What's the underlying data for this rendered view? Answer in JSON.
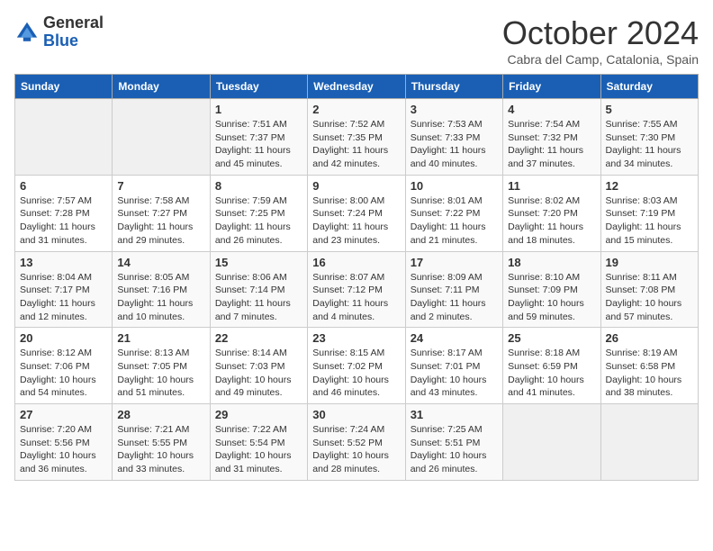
{
  "header": {
    "logo_general": "General",
    "logo_blue": "Blue",
    "month": "October 2024",
    "location": "Cabra del Camp, Catalonia, Spain"
  },
  "days_of_week": [
    "Sunday",
    "Monday",
    "Tuesday",
    "Wednesday",
    "Thursday",
    "Friday",
    "Saturday"
  ],
  "weeks": [
    [
      {
        "day": "",
        "info": ""
      },
      {
        "day": "",
        "info": ""
      },
      {
        "day": "1",
        "info": "Sunrise: 7:51 AM\nSunset: 7:37 PM\nDaylight: 11 hours and 45 minutes."
      },
      {
        "day": "2",
        "info": "Sunrise: 7:52 AM\nSunset: 7:35 PM\nDaylight: 11 hours and 42 minutes."
      },
      {
        "day": "3",
        "info": "Sunrise: 7:53 AM\nSunset: 7:33 PM\nDaylight: 11 hours and 40 minutes."
      },
      {
        "day": "4",
        "info": "Sunrise: 7:54 AM\nSunset: 7:32 PM\nDaylight: 11 hours and 37 minutes."
      },
      {
        "day": "5",
        "info": "Sunrise: 7:55 AM\nSunset: 7:30 PM\nDaylight: 11 hours and 34 minutes."
      }
    ],
    [
      {
        "day": "6",
        "info": "Sunrise: 7:57 AM\nSunset: 7:28 PM\nDaylight: 11 hours and 31 minutes."
      },
      {
        "day": "7",
        "info": "Sunrise: 7:58 AM\nSunset: 7:27 PM\nDaylight: 11 hours and 29 minutes."
      },
      {
        "day": "8",
        "info": "Sunrise: 7:59 AM\nSunset: 7:25 PM\nDaylight: 11 hours and 26 minutes."
      },
      {
        "day": "9",
        "info": "Sunrise: 8:00 AM\nSunset: 7:24 PM\nDaylight: 11 hours and 23 minutes."
      },
      {
        "day": "10",
        "info": "Sunrise: 8:01 AM\nSunset: 7:22 PM\nDaylight: 11 hours and 21 minutes."
      },
      {
        "day": "11",
        "info": "Sunrise: 8:02 AM\nSunset: 7:20 PM\nDaylight: 11 hours and 18 minutes."
      },
      {
        "day": "12",
        "info": "Sunrise: 8:03 AM\nSunset: 7:19 PM\nDaylight: 11 hours and 15 minutes."
      }
    ],
    [
      {
        "day": "13",
        "info": "Sunrise: 8:04 AM\nSunset: 7:17 PM\nDaylight: 11 hours and 12 minutes."
      },
      {
        "day": "14",
        "info": "Sunrise: 8:05 AM\nSunset: 7:16 PM\nDaylight: 11 hours and 10 minutes."
      },
      {
        "day": "15",
        "info": "Sunrise: 8:06 AM\nSunset: 7:14 PM\nDaylight: 11 hours and 7 minutes."
      },
      {
        "day": "16",
        "info": "Sunrise: 8:07 AM\nSunset: 7:12 PM\nDaylight: 11 hours and 4 minutes."
      },
      {
        "day": "17",
        "info": "Sunrise: 8:09 AM\nSunset: 7:11 PM\nDaylight: 11 hours and 2 minutes."
      },
      {
        "day": "18",
        "info": "Sunrise: 8:10 AM\nSunset: 7:09 PM\nDaylight: 10 hours and 59 minutes."
      },
      {
        "day": "19",
        "info": "Sunrise: 8:11 AM\nSunset: 7:08 PM\nDaylight: 10 hours and 57 minutes."
      }
    ],
    [
      {
        "day": "20",
        "info": "Sunrise: 8:12 AM\nSunset: 7:06 PM\nDaylight: 10 hours and 54 minutes."
      },
      {
        "day": "21",
        "info": "Sunrise: 8:13 AM\nSunset: 7:05 PM\nDaylight: 10 hours and 51 minutes."
      },
      {
        "day": "22",
        "info": "Sunrise: 8:14 AM\nSunset: 7:03 PM\nDaylight: 10 hours and 49 minutes."
      },
      {
        "day": "23",
        "info": "Sunrise: 8:15 AM\nSunset: 7:02 PM\nDaylight: 10 hours and 46 minutes."
      },
      {
        "day": "24",
        "info": "Sunrise: 8:17 AM\nSunset: 7:01 PM\nDaylight: 10 hours and 43 minutes."
      },
      {
        "day": "25",
        "info": "Sunrise: 8:18 AM\nSunset: 6:59 PM\nDaylight: 10 hours and 41 minutes."
      },
      {
        "day": "26",
        "info": "Sunrise: 8:19 AM\nSunset: 6:58 PM\nDaylight: 10 hours and 38 minutes."
      }
    ],
    [
      {
        "day": "27",
        "info": "Sunrise: 7:20 AM\nSunset: 5:56 PM\nDaylight: 10 hours and 36 minutes."
      },
      {
        "day": "28",
        "info": "Sunrise: 7:21 AM\nSunset: 5:55 PM\nDaylight: 10 hours and 33 minutes."
      },
      {
        "day": "29",
        "info": "Sunrise: 7:22 AM\nSunset: 5:54 PM\nDaylight: 10 hours and 31 minutes."
      },
      {
        "day": "30",
        "info": "Sunrise: 7:24 AM\nSunset: 5:52 PM\nDaylight: 10 hours and 28 minutes."
      },
      {
        "day": "31",
        "info": "Sunrise: 7:25 AM\nSunset: 5:51 PM\nDaylight: 10 hours and 26 minutes."
      },
      {
        "day": "",
        "info": ""
      },
      {
        "day": "",
        "info": ""
      }
    ]
  ]
}
